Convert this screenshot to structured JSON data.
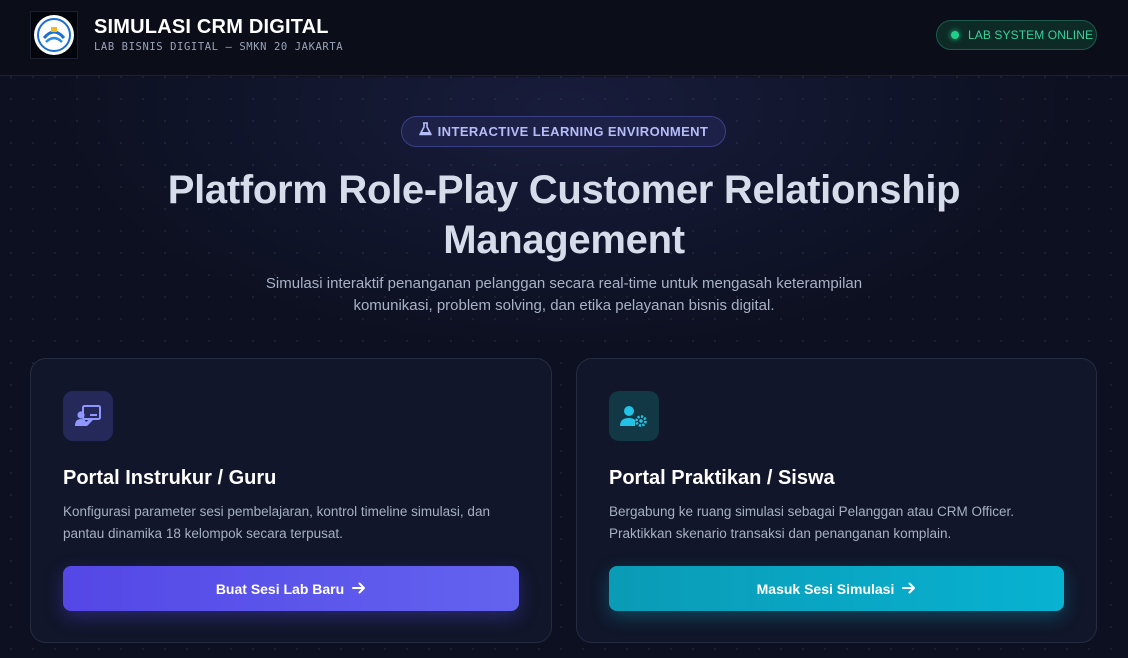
{
  "header": {
    "title": "SIMULASI CRM DIGITAL",
    "subtitle": "LAB BISNIS DIGITAL — SMKN 20 JAKARTA",
    "status": "LAB SYSTEM ONLINE",
    "logo_icon": "school-logo"
  },
  "hero": {
    "badge": "INTERACTIVE LEARNING ENVIRONMENT",
    "badge_icon": "flask-icon",
    "title": "Platform Role-Play Customer Relationship Management",
    "description": "Simulasi interaktif penanganan pelanggan secara real-time untuk mengasah keterampilan komunikasi, problem solving, dan etika pelayanan bisnis digital."
  },
  "portals": {
    "instructor": {
      "icon": "chalkboard-teacher-icon",
      "title": "Portal Instrukur / Guru",
      "description": "Konfigurasi parameter sesi pembelajaran, kontrol timeline simulasi, dan pantau dinamika 18 kelompok secara terpusat.",
      "button_label": "Buat Sesi Lab Baru",
      "button_icon": "arrow-right-icon"
    },
    "student": {
      "icon": "user-gear-icon",
      "title": "Portal Praktikan / Siswa",
      "description": "Bergabung ke ruang simulasi sebagai Pelanggan atau CRM Officer. Praktikkan skenario transaksi dan penanganan komplain.",
      "button_label": "Masuk Sesi Simulasi",
      "button_icon": "arrow-right-icon"
    }
  },
  "colors": {
    "background": "#0c1020",
    "accent_indigo": "#5b50eb",
    "accent_cyan": "#08aecd",
    "status_green": "#1fcf8a"
  }
}
